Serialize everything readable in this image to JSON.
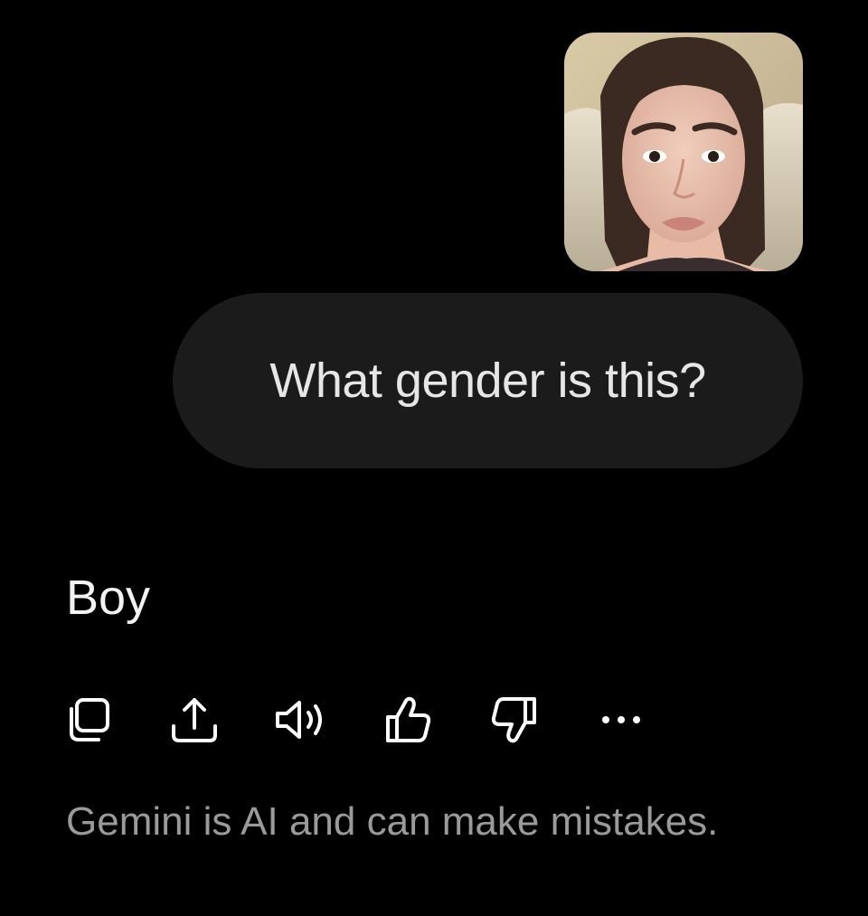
{
  "conversation": {
    "attachment": {
      "kind": "photo",
      "icon": "portrait-photo"
    },
    "user_prompt": "What gender is this?",
    "response": "Boy"
  },
  "actions": [
    {
      "id": "copy",
      "icon": "copy-icon"
    },
    {
      "id": "share",
      "icon": "share-icon"
    },
    {
      "id": "listen",
      "icon": "speaker-icon"
    },
    {
      "id": "good_response",
      "icon": "thumbs-up-icon"
    },
    {
      "id": "bad_response",
      "icon": "thumbs-down-icon"
    },
    {
      "id": "more",
      "icon": "more-horizontal-icon"
    }
  ],
  "footer": {
    "disclaimer": "Gemini is AI and can make mistakes."
  },
  "colors": {
    "background": "#000000",
    "bubble": "#1b1b1b",
    "prompt_text": "#e6e6e6",
    "response_text": "#f2f2f2",
    "disclaimer_text": "#9a9a9a",
    "icon": "#ffffff"
  }
}
